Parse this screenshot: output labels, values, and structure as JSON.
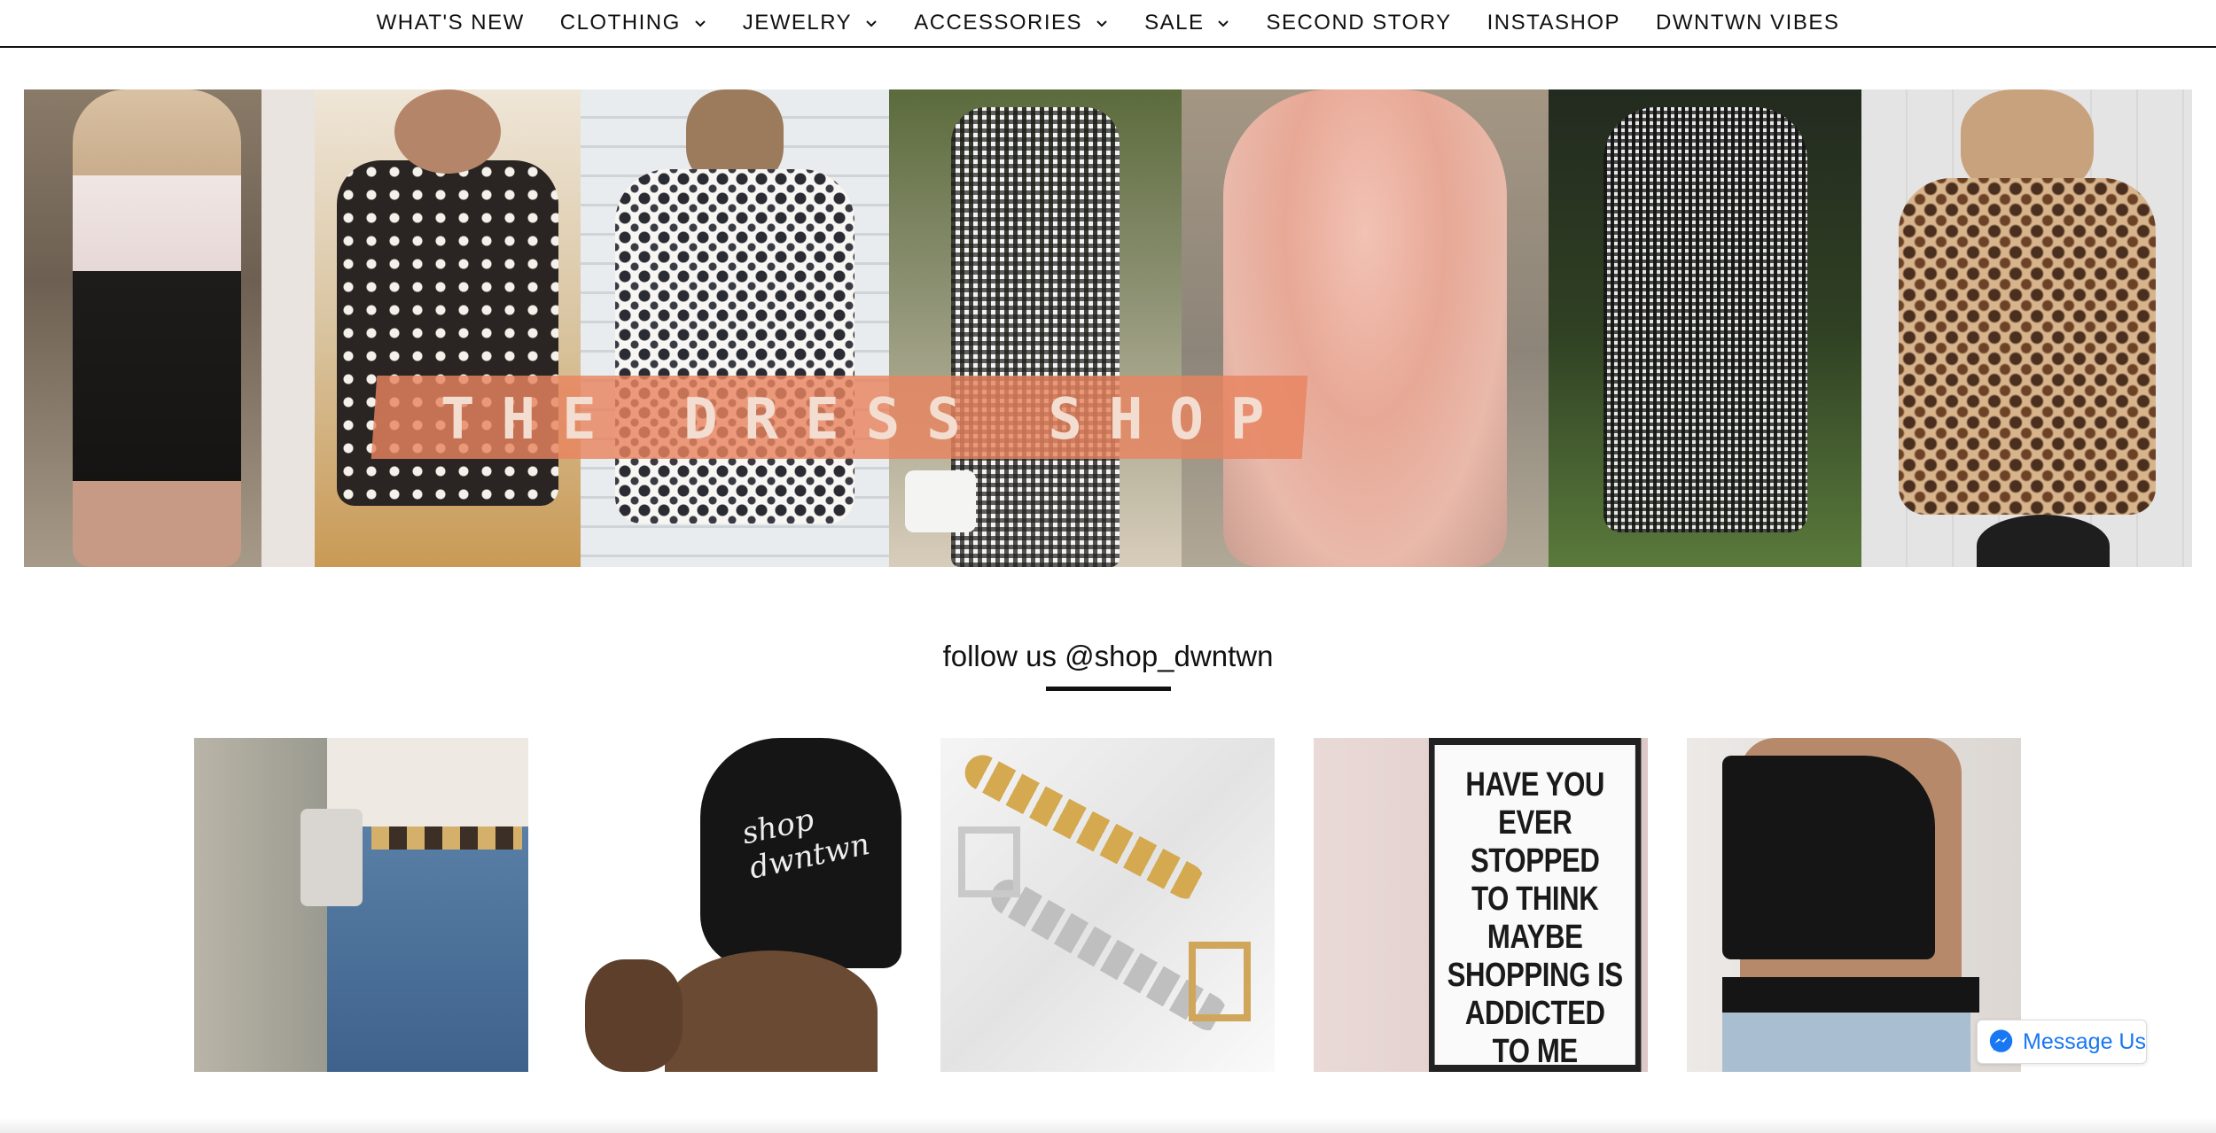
{
  "nav": {
    "items": [
      {
        "label": "WHAT'S NEW",
        "has_dropdown": false
      },
      {
        "label": "CLOTHING",
        "has_dropdown": true
      },
      {
        "label": "JEWELRY",
        "has_dropdown": true
      },
      {
        "label": "ACCESSORIES",
        "has_dropdown": true
      },
      {
        "label": "SALE",
        "has_dropdown": true
      },
      {
        "label": "SECOND STORY",
        "has_dropdown": false
      },
      {
        "label": "INSTASHOP",
        "has_dropdown": false
      },
      {
        "label": "DWNTWN VIBES",
        "has_dropdown": false
      }
    ]
  },
  "hero": {
    "banner_text": "THE DRESS SHOP",
    "banner_color": "#e8845f"
  },
  "instagram": {
    "heading": "follow us @shop_dwntwn",
    "sign_text": [
      "HAVE YOU",
      "EVER STOPPED",
      "TO THINK",
      "MAYBE",
      "SHOPPING IS",
      "ADDICTED",
      "TO ME"
    ],
    "cap_text": "shop dwntwn"
  },
  "messenger": {
    "label": "Message Us",
    "color": "#1877f2"
  }
}
